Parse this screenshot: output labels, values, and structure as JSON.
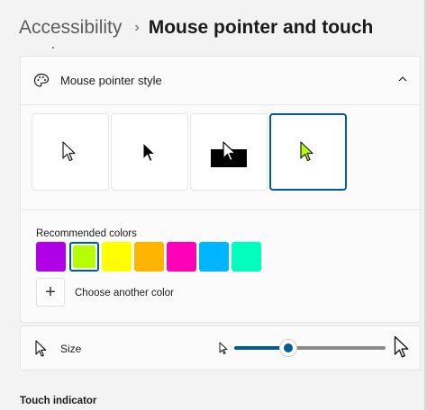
{
  "breadcrumb": {
    "parent": "Accessibility",
    "separator": "›",
    "current": "Mouse pointer and touch"
  },
  "pointer_style": {
    "label": "Mouse pointer style",
    "icon": "palette-icon",
    "expanded": true,
    "options": [
      {
        "name": "white",
        "selected": false
      },
      {
        "name": "black",
        "selected": false
      },
      {
        "name": "inverted",
        "selected": false
      },
      {
        "name": "custom",
        "selected": true
      }
    ],
    "custom_color": "#b6ff00"
  },
  "colors": {
    "label": "Recommended colors",
    "swatches": [
      "#b000e8",
      "#b6ff00",
      "#ffff00",
      "#ffb400",
      "#ff00b8",
      "#00b4ff",
      "#00ffbd"
    ],
    "selected_index": 1,
    "add_label": "Choose another color",
    "add_symbol": "+"
  },
  "size": {
    "label": "Size",
    "value_fraction": 0.36,
    "accent": "#005a9e"
  },
  "touch_indicator": {
    "label": "Touch indicator"
  }
}
